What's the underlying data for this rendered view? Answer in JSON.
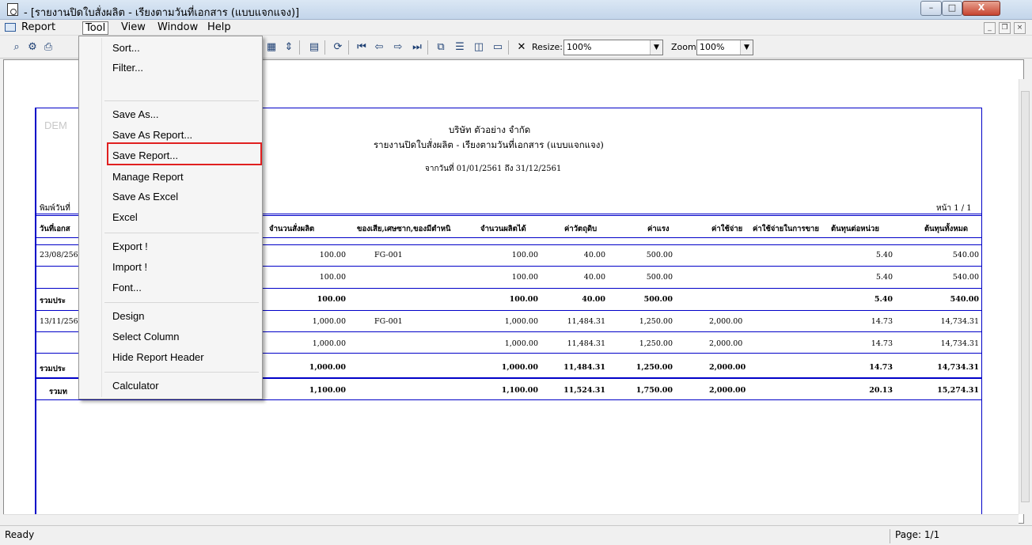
{
  "window": {
    "title": "- [รายงานปิดใบสั่งผลิต - เรียงตามวันที่เอกสาร (แบบแจกแจง)]",
    "min_label": "–",
    "max_label": "□",
    "close_label": "X"
  },
  "menubar": {
    "items": [
      "Report",
      "Tool",
      "View",
      "Window",
      "Help"
    ],
    "mdi_min": "_",
    "mdi_restore": "❐",
    "mdi_close": "×"
  },
  "toolbar": {
    "resize_label": "Resize:",
    "resize_value": "100%",
    "zoom_label": "Zoom:",
    "zoom_value": "100%"
  },
  "tool_menu": {
    "items": [
      "Sort...",
      "Filter...",
      "Save As...",
      "Save As Report...",
      "Save Report...",
      "Manage Report",
      "Save As Excel",
      "Excel",
      "Export !",
      "Import !",
      "Font...",
      "Design",
      "Select Column",
      "Hide Report Header",
      "Calculator"
    ],
    "highlighted": "Save Report..."
  },
  "report": {
    "watermark": "DEM",
    "company": "บริษัท ตัวอย่าง จำกัด",
    "title": "รายงานปิดใบสั่งผลิต - เรียงตามวันที่เอกสาร (แบบแจกแจง)",
    "date_range": "จากวันที่ 01/01/2561 ถึง 31/12/2561",
    "print_date_label": "พิมพ์วันที่",
    "page_label": "หน้า 1 / 1",
    "columns": [
      "วันที่เอกส",
      "จำนวนสั่งผลิต",
      "ของเสีย,เศษซาก,ของมีตำหนิ",
      "จำนวนผลิตได้",
      "ค่าวัตถุดิบ",
      "ค่าแรง",
      "ค่าใช้จ่าย",
      "ค่าใช้จ่ายในการขาย",
      "ต้นทุนต่อหน่วย",
      "ต้นทุนทั้งหมด"
    ],
    "rows": [
      {
        "date": "23/08/256",
        "order_qty": "100.00",
        "defect": "FG-001",
        "produced": "100.00",
        "material": "40.00",
        "labor": "500.00",
        "expense": "",
        "unit_cost": "5.40",
        "total_cost": "540.00",
        "bold": false
      },
      {
        "date": "",
        "order_qty": "100.00",
        "defect": "",
        "produced": "100.00",
        "material": "40.00",
        "labor": "500.00",
        "expense": "",
        "unit_cost": "5.40",
        "total_cost": "540.00",
        "bold": false
      },
      {
        "date": "รวมประ",
        "order_qty": "100.00",
        "defect": "",
        "produced": "100.00",
        "material": "40.00",
        "labor": "500.00",
        "expense": "",
        "unit_cost": "5.40",
        "total_cost": "540.00",
        "bold": true
      },
      {
        "date": "13/11/256",
        "order_qty": "1,000.00",
        "defect": "FG-001",
        "produced": "1,000.00",
        "material": "11,484.31",
        "labor": "1,250.00",
        "expense": "2,000.00",
        "unit_cost": "14.73",
        "total_cost": "14,734.31",
        "bold": false
      },
      {
        "date": "",
        "order_qty": "1,000.00",
        "defect": "",
        "produced": "1,000.00",
        "material": "11,484.31",
        "labor": "1,250.00",
        "expense": "2,000.00",
        "unit_cost": "14.73",
        "total_cost": "14,734.31",
        "bold": false
      },
      {
        "date": "รวมประ",
        "order_qty": "1,000.00",
        "defect": "",
        "produced": "1,000.00",
        "material": "11,484.31",
        "labor": "1,250.00",
        "expense": "2,000.00",
        "unit_cost": "14.73",
        "total_cost": "14,734.31",
        "bold": true
      },
      {
        "date": "รวมท",
        "order_qty": "1,100.00",
        "defect": "",
        "produced": "1,100.00",
        "material": "11,524.31",
        "labor": "1,750.00",
        "expense": "2,000.00",
        "unit_cost": "20.13",
        "total_cost": "15,274.31",
        "bold": true
      }
    ]
  },
  "statusbar": {
    "ready": "Ready",
    "page": "Page: 1/1"
  },
  "colors": {
    "report_line": "#0000c8",
    "highlight": "#e02020"
  }
}
